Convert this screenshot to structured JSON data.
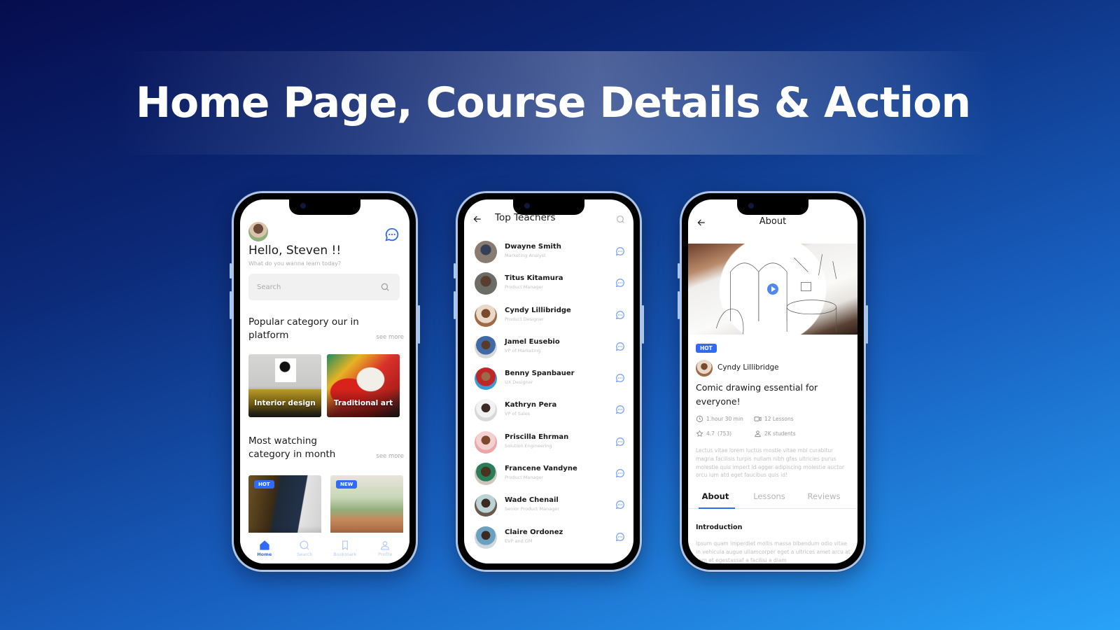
{
  "banner": {
    "title": "Home Page, Course Details & Action"
  },
  "colors": {
    "accent": "#2f6bf6",
    "background_start": "#060d4e",
    "background_end": "#28a3f8"
  },
  "home": {
    "greeting": "Hello, Steven !!",
    "subtitle": "What do you wanna learn today?",
    "search_placeholder": "Search",
    "popular": {
      "title": "Popular category our  in platform",
      "see_more": "see more",
      "cards": [
        {
          "label": "Interior design"
        },
        {
          "label": "Traditional art"
        }
      ]
    },
    "most_watching": {
      "title": "Most watching category in month",
      "see_more": "see more",
      "cards": [
        {
          "badge": "HOT"
        },
        {
          "badge": "NEW"
        }
      ]
    },
    "tabbar": [
      {
        "label": "Home",
        "icon": "home-icon",
        "active": true
      },
      {
        "label": "Search",
        "icon": "search-icon",
        "active": false
      },
      {
        "label": "Bookmark",
        "icon": "bookmark-icon",
        "active": false
      },
      {
        "label": "Profile",
        "icon": "profile-icon",
        "active": false
      }
    ]
  },
  "teachers": {
    "title": "Top Teachers",
    "list": [
      {
        "name": "Dwayne Smith",
        "role": "Marketing Analyst"
      },
      {
        "name": "Titus Kitamura",
        "role": "Product Manager"
      },
      {
        "name": "Cyndy Lillibridge",
        "role": "Product Designer"
      },
      {
        "name": "Jamel Eusebio",
        "role": "VP of Marketing"
      },
      {
        "name": "Benny Spanbauer",
        "role": "UX Designer"
      },
      {
        "name": "Kathryn Pera",
        "role": "VP of Sales"
      },
      {
        "name": "Priscilla Ehrman",
        "role": "Solution Engineering"
      },
      {
        "name": "Francene Vandyne",
        "role": "Product Manager"
      },
      {
        "name": "Wade Chenail",
        "role": "Senior Product Manager"
      },
      {
        "name": "Claire Ordonez",
        "role": "EVP and GM"
      }
    ]
  },
  "course": {
    "header_title": "About",
    "badge": "HOT",
    "author": "Cyndy Lillibridge",
    "title": "Comic drawing essential for everyone!",
    "duration": "1.hour 30 min",
    "lessons": "12 Lessons",
    "rating": "4.7",
    "rating_count": "(753)",
    "students": "2K  students",
    "description": "Lectus vitae lorem luctus mostie vitae mbi curabitur magna facilisis turpis nullam nibh gfas ultricies purus molestie quis impert id agger adipiscing molestie auctor orcu ium  atd eget faucibus quis id!",
    "tabs": [
      {
        "label": "About",
        "active": true
      },
      {
        "label": "Lessons",
        "active": false
      },
      {
        "label": "Reviews",
        "active": false
      }
    ],
    "intro_heading": "Introduction",
    "intro_text": "Ipsum quam imperdiet mollis massa bibendum odio vitae in vehicula augue ullamcorper eget a ultrices amet arcu at sem et egestassaf a facilisi a diam"
  }
}
